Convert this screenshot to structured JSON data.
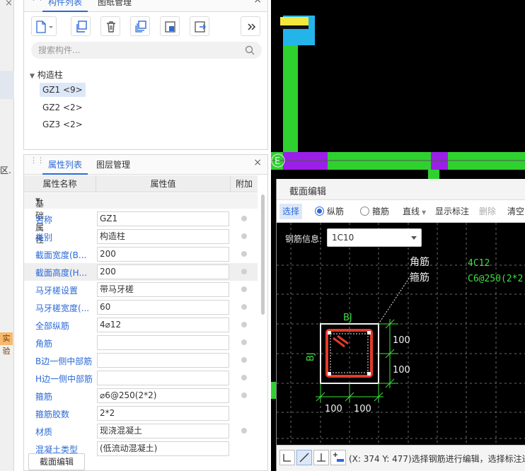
{
  "left_strip": {
    "close": "×",
    "partial_text": "区.",
    "badge": "实验"
  },
  "comp_panel": {
    "tabs": [
      "构件列表",
      "图纸管理"
    ],
    "close": "×",
    "search_placeholder": "搜索构件...",
    "tree_root": "构造柱",
    "items": [
      "GZ1 <9>",
      "GZ2 <2>",
      "GZ3 <2>"
    ]
  },
  "prop_panel": {
    "tabs": [
      "属性列表",
      "图层管理"
    ],
    "close": "×",
    "columns": [
      "属性名称",
      "属性值",
      "附加"
    ],
    "group": "基础属性",
    "rows": [
      {
        "name": "名称",
        "value": "GZ1"
      },
      {
        "name": "类别",
        "value": "构造柱"
      },
      {
        "name": "截面宽度(B...",
        "value": "200"
      },
      {
        "name": "截面高度(H...",
        "value": "200"
      },
      {
        "name": "马牙槎设置",
        "value": "带马牙槎"
      },
      {
        "name": "马牙槎宽度(...",
        "value": "60"
      },
      {
        "name": "全部纵筋",
        "value": "4⌀12"
      },
      {
        "name": "角筋",
        "value": ""
      },
      {
        "name": "B边一侧中部筋",
        "value": ""
      },
      {
        "name": "H边一侧中部筋",
        "value": ""
      },
      {
        "name": "箍筋",
        "value": "⌀6@250(2*2)"
      },
      {
        "name": "箍筋胶数",
        "value": "2*2"
      },
      {
        "name": "材质",
        "value": "现浇混凝土"
      },
      {
        "name": "混凝土类型",
        "value": "(低流动混凝土)"
      }
    ],
    "bottom_button": "截面编辑"
  },
  "cad": {
    "axis_label": "E"
  },
  "section_editor": {
    "title": "截面编辑",
    "toolbar": {
      "select": "选择",
      "radio_long": "纵筋",
      "radio_stirrup": "箍筋",
      "line": "直线",
      "show_label": "显示标注",
      "delete": "删除",
      "clear": "清空"
    },
    "rebar_info_label": "钢筋信息:",
    "rebar_info_value": "1C10",
    "labels": {
      "corner": "角筋",
      "stirrup": "箍筋",
      "corner_value": "4C12",
      "stirrup_value": "C6@250(2*2)",
      "bj_top": "BJ",
      "bj_left": "BJ",
      "dim_r1": "100",
      "dim_r2": "100",
      "dim_b1": "100",
      "dim_b2": "100"
    },
    "status_text": "(X: 374 Y: 477)选择钢筋进行编辑，选择标注进"
  },
  "colors": {
    "accent": "#2a6ad8",
    "cad_green": "#2fd12f",
    "cad_purple": "#9b1fe8",
    "cad_cyan": "#23b5ea",
    "rebar_red": "#e33a2a",
    "dim_green": "#3fe03f"
  }
}
